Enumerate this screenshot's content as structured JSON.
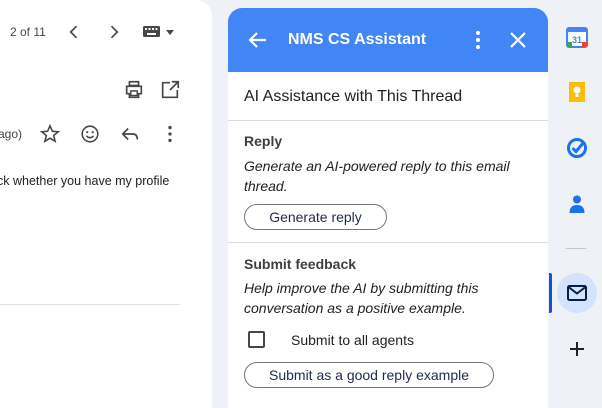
{
  "mail": {
    "pager": "2 of 11",
    "time_ago_fragment": "ago)",
    "snippet": "ck whether you have my profile"
  },
  "panel": {
    "title": "NMS CS Assistant",
    "section_title": "AI Assistance with This Thread",
    "reply": {
      "heading": "Reply",
      "description": "Generate an AI-powered reply to this email thread.",
      "button_label": "Generate reply"
    },
    "feedback": {
      "heading": "Submit feedback",
      "description": "Help improve the AI by submitting this conversation as a positive example.",
      "checkbox_label": "Submit to all agents",
      "checkbox_checked": false,
      "button_label": "Submit as a good reply example"
    }
  },
  "colors": {
    "header": "#4285f4",
    "rail_active": "#d3e3fd",
    "accent": "#0b57d0"
  },
  "icons": {
    "panel_header": [
      "back-arrow-icon",
      "more-vert-icon",
      "close-icon"
    ],
    "mail_toolbar": [
      "chevron-left-icon",
      "chevron-right-icon",
      "keyboard-icon",
      "print-icon",
      "open-in-new-icon",
      "star-icon",
      "emoji-icon",
      "reply-icon",
      "more-vert-icon"
    ],
    "rail": [
      "calendar-icon",
      "keep-icon",
      "tasks-icon",
      "contacts-icon",
      "mail-icon",
      "add-icon"
    ]
  },
  "rail": {
    "calendar_day": "31"
  }
}
